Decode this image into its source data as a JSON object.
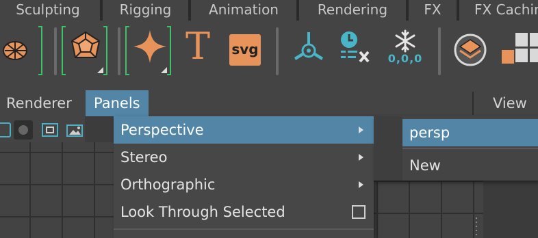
{
  "shelf_tabs": [
    "Sculpting",
    "Rigging",
    "Animation",
    "Rendering",
    "FX",
    "FX Caching"
  ],
  "shelf_tools": {
    "svg_label": "svg",
    "text_tool_label": "T",
    "cache_readout": "0,0,0"
  },
  "panel_menubar": {
    "renderer": "Renderer",
    "panels": "Panels",
    "view": "View"
  },
  "panels_menu": {
    "items": [
      {
        "label": "Perspective",
        "submenu": true,
        "selected": true
      },
      {
        "label": "Stereo",
        "submenu": true
      },
      {
        "label": "Orthographic",
        "submenu": true
      },
      {
        "label": "Look Through Selected",
        "checkbox": true,
        "checked": false
      }
    ]
  },
  "perspective_submenu": {
    "items": [
      "persp",
      "New"
    ]
  },
  "colors": {
    "highlight": "#5285a6",
    "tool_orange": "#e8935a",
    "tool_teal": "#48b5c8",
    "bracket_green": "#3fc16a"
  }
}
